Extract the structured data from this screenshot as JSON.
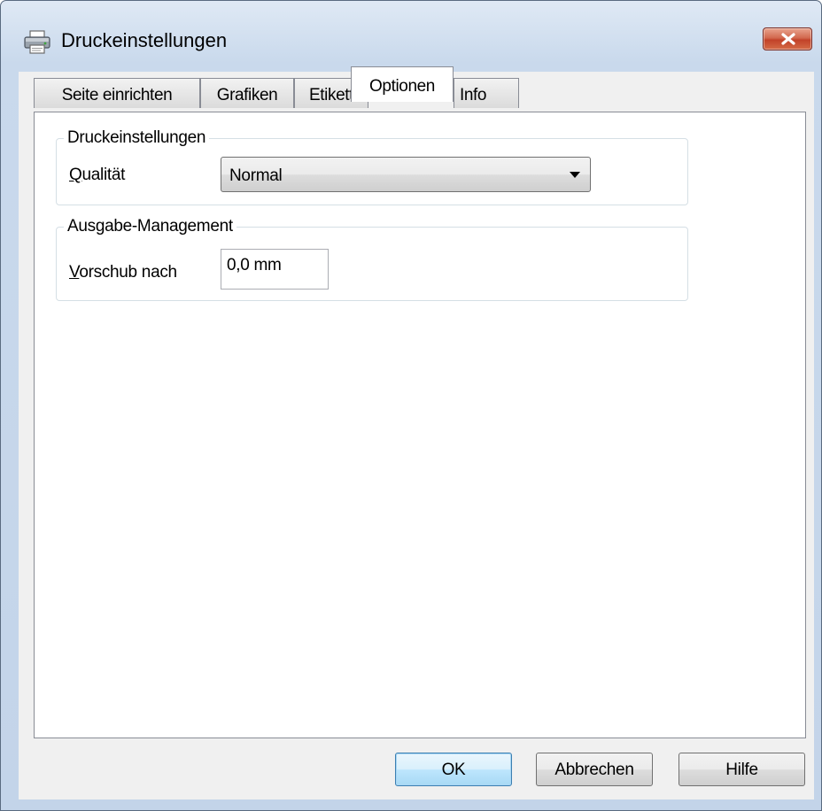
{
  "window": {
    "title": "Druckeinstellungen",
    "icon": "printer-icon",
    "close_icon": "close-icon"
  },
  "tabs": [
    {
      "label": "Seite einrichten",
      "active": false
    },
    {
      "label": "Grafiken",
      "active": false
    },
    {
      "label": "Etikett",
      "active": false
    },
    {
      "label": "Optionen",
      "active": true
    },
    {
      "label": "Info",
      "active": false
    }
  ],
  "groups": {
    "print_settings": {
      "title": "Druckeinstellungen",
      "quality_label_mnemonic": "Q",
      "quality_label_rest": "ualität",
      "quality_value": "Normal",
      "dropdown_icon": "dropdown-arrow-icon"
    },
    "output_management": {
      "title": "Ausgabe-Management",
      "feed_label_mnemonic": "V",
      "feed_label_rest": "orschub nach",
      "feed_value": "0,0 mm"
    }
  },
  "buttons": {
    "ok": "OK",
    "cancel": "Abbrechen",
    "help": "Hilfe"
  },
  "colors": {
    "titlebar": "#c9d9ec",
    "close_button": "#c24229",
    "default_button_border": "#3c7fb1"
  }
}
